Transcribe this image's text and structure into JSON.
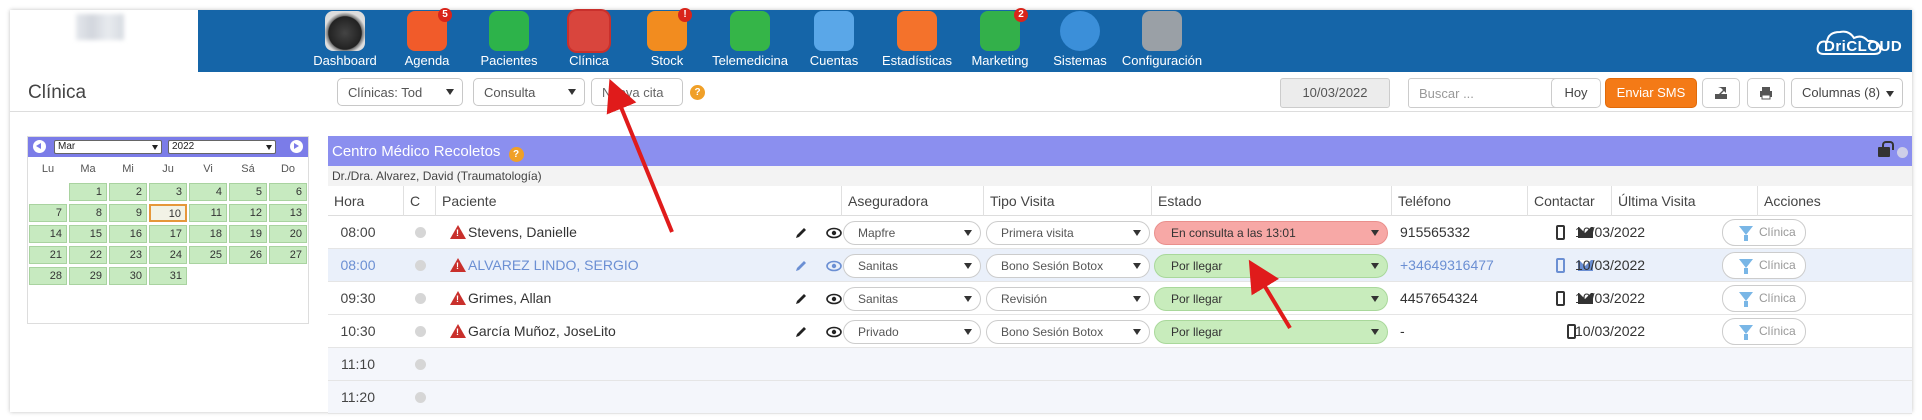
{
  "nav": {
    "items": [
      {
        "label": "Dashboard",
        "badge": ""
      },
      {
        "label": "Agenda",
        "badge": "5"
      },
      {
        "label": "Pacientes",
        "badge": ""
      },
      {
        "label": "Clínica",
        "badge": ""
      },
      {
        "label": "Stock",
        "badge": "!"
      },
      {
        "label": "Telemedicina",
        "badge": ""
      },
      {
        "label": "Cuentas",
        "badge": ""
      },
      {
        "label": "Estadísticas",
        "badge": ""
      },
      {
        "label": "Marketing",
        "badge": "2"
      },
      {
        "label": "Sistemas",
        "badge": ""
      },
      {
        "label": "Configuración",
        "badge": ""
      }
    ],
    "active": "Clínica",
    "brand": "DriCLOUD"
  },
  "toolbar": {
    "title": "Clínica",
    "clinicas_select": "Clínicas: Tod",
    "tipo_select": "Consulta",
    "nueva_cita": "Nueva cita",
    "help": "?",
    "date": "10/03/2022",
    "search_placeholder": "Buscar ...",
    "hoy": "Hoy",
    "enviar_sms": "Enviar SMS",
    "columnas": "Columnas (8)"
  },
  "calendar": {
    "month": "Mar",
    "year": "2022",
    "weekdays": [
      "Lu",
      "Ma",
      "Mi",
      "Ju",
      "Vi",
      "Sá",
      "Do"
    ],
    "days": [
      "1",
      "2",
      "3",
      "4",
      "5",
      "6",
      "7",
      "8",
      "9",
      "10",
      "11",
      "12",
      "13",
      "14",
      "15",
      "16",
      "17",
      "18",
      "19",
      "20",
      "21",
      "22",
      "23",
      "24",
      "25",
      "26",
      "27",
      "28",
      "29",
      "30",
      "31"
    ],
    "today": "10"
  },
  "panel": {
    "center": "Centro Médico Recoletos",
    "doctor": "Dr./Dra. Alvarez, David (Traumatología)",
    "columns": [
      "Hora",
      "C",
      "Paciente",
      "Aseguradora",
      "Tipo Visita",
      "Estado",
      "Teléfono",
      "Contactar",
      "Última Visita",
      "Acciones"
    ],
    "rows": [
      {
        "hora": "08:00",
        "paciente": "Stevens, Danielle",
        "aseguradora": "Mapfre",
        "tipo": "Primera visita",
        "estado": "En consulta a las 13:01",
        "estado_color": "#f7a8a6",
        "telefono": "915565332",
        "ultima": "10/03/2022",
        "accion": "Clínica",
        "mail": true
      },
      {
        "hora": "08:00",
        "paciente": "ALVAREZ LINDO, SERGIO",
        "aseguradora": "Sanitas",
        "tipo": "Bono Sesión Botox",
        "estado": "Por llegar",
        "estado_color": "#c8ecbc",
        "telefono": "+34649316477",
        "ultima": "10/03/2022",
        "accion": "Clínica",
        "mail": true
      },
      {
        "hora": "09:30",
        "paciente": "Grimes, Allan",
        "aseguradora": "Sanitas",
        "tipo": "Revisión",
        "estado": "Por llegar",
        "estado_color": "#c8ecbc",
        "telefono": "4457654324",
        "ultima": "10/03/2022",
        "accion": "Clínica",
        "mail": true
      },
      {
        "hora": "10:30",
        "paciente": "García Muñoz, JoseLito",
        "aseguradora": "Privado",
        "tipo": "Bono Sesión Botox",
        "estado": "Por llegar",
        "estado_color": "#c8ecbc",
        "telefono": "-",
        "ultima": "10/03/2022",
        "accion": "Clínica",
        "mail": false
      }
    ],
    "empty_rows": [
      "11:10",
      "11:20"
    ]
  },
  "colors": {
    "nav_bg": "#1565a8",
    "panel_head": "#8b8fef",
    "accent_orange": "#f47a16",
    "annotation_arrow": "#e01b1b"
  }
}
